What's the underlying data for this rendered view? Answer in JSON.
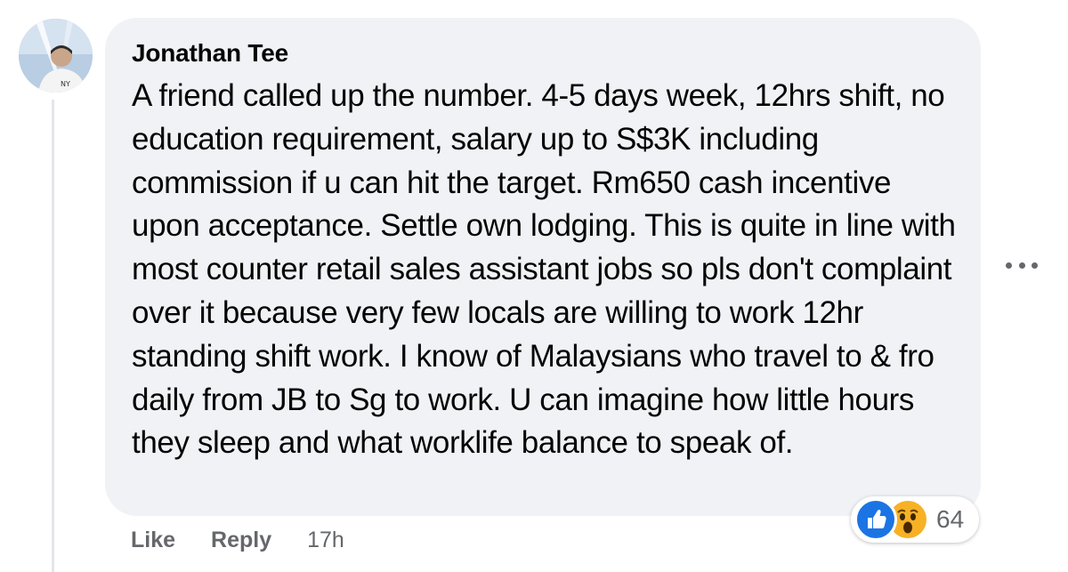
{
  "comment": {
    "author": "Jonathan Tee",
    "text": "A friend called up the number. 4-5 days week, 12hrs shift, no education requirement, salary up to S$3K including commission if u can hit the target. Rm650 cash incentive upon acceptance. Settle own lodging. This is quite in line with most counter retail sales assistant jobs so pls don't complaint over it because very few locals are willing to work 12hr standing shift work. I know of Malaysians who travel to & fro daily from JB to Sg to work. U can imagine how little hours they sleep and what worklife balance to speak of.",
    "reaction_count": "64",
    "reaction_icons": [
      "like-icon",
      "wow-icon"
    ],
    "more_icon": "more-options-icon"
  },
  "actions": {
    "like_label": "Like",
    "reply_label": "Reply",
    "timestamp": "17h"
  },
  "colors": {
    "bubble": "#f0f2f5",
    "secondary_text": "#65676b",
    "like_blue": "#1b74e4",
    "wow_yellow": "#f7b125"
  }
}
